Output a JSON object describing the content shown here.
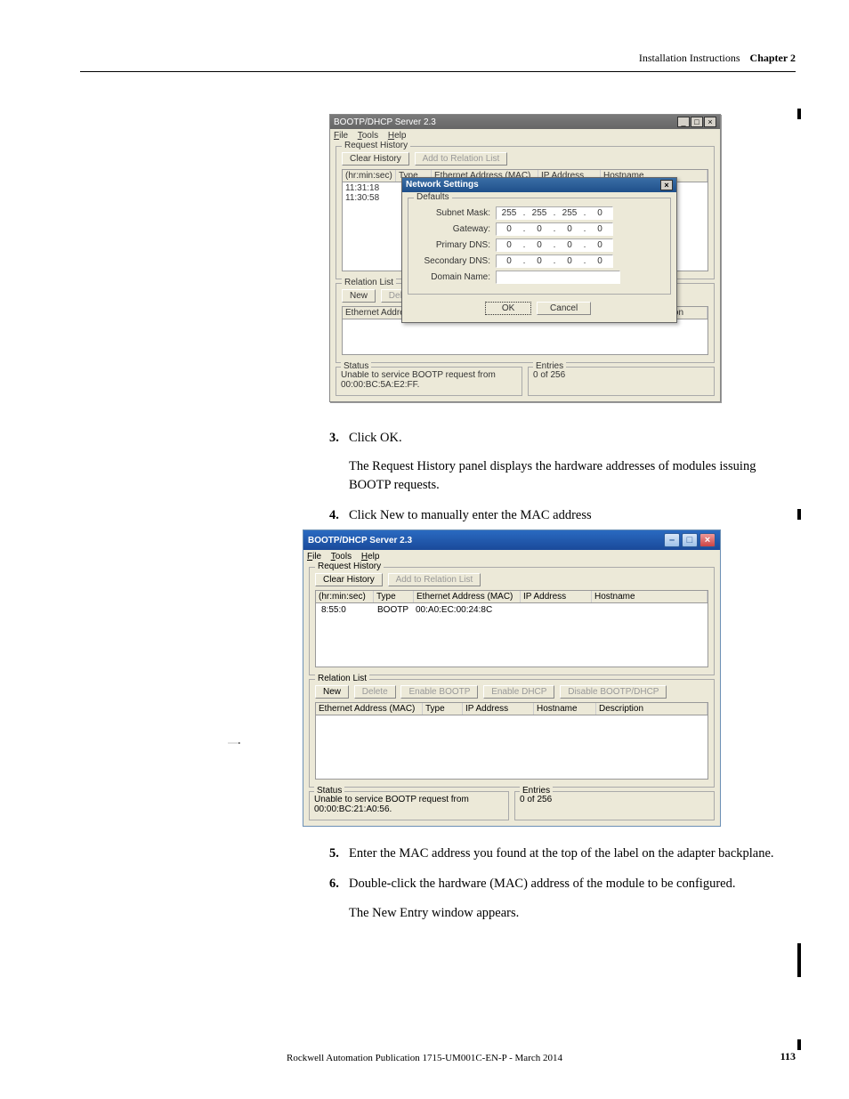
{
  "header": {
    "title": "Installation Instructions",
    "chapter": "Chapter 2"
  },
  "winOld": {
    "title": "BOOTP/DHCP Server 2.3",
    "menu": {
      "file": "File",
      "tools": "Tools",
      "help": "Help"
    },
    "reqHistory": {
      "legend": "Request History",
      "clearBtn": "Clear History",
      "addBtn": "Add to Relation List",
      "cols": {
        "time": "(hr:min:sec)",
        "type": "Type",
        "mac": "Ethernet Address (MAC)",
        "ip": "IP Address",
        "host": "Hostname"
      },
      "rows": [
        {
          "time": "11:31:18"
        },
        {
          "time": "11:30:58"
        }
      ]
    },
    "relList": {
      "legend": "Relation List",
      "newBtn": "New",
      "delBtn": "Delete",
      "col_mac": "Ethernet Addre",
      "col_desc": "Description"
    },
    "dialog": {
      "title": "Network Settings",
      "defaults": "Defaults",
      "subnet": {
        "label": "Subnet Mask:",
        "a": "255",
        "b": "255",
        "c": "255",
        "d": "0"
      },
      "gateway": {
        "label": "Gateway:",
        "a": "0",
        "b": "0",
        "c": "0",
        "d": "0"
      },
      "pdns": {
        "label": "Primary DNS:",
        "a": "0",
        "b": "0",
        "c": "0",
        "d": "0"
      },
      "sdns": {
        "label": "Secondary DNS:",
        "a": "0",
        "b": "0",
        "c": "0",
        "d": "0"
      },
      "domain": {
        "label": "Domain Name:",
        "value": ""
      },
      "ok": "OK",
      "cancel": "Cancel"
    },
    "status": {
      "legend": "Status",
      "text": "Unable to service BOOTP request from 00:00:BC:5A:E2:FF."
    },
    "entries": {
      "legend": "Entries",
      "text": "0 of 256"
    }
  },
  "steps": {
    "s3": {
      "num": "3.",
      "text": "Click OK.",
      "follow": "The Request History panel displays the hardware addresses of modules issuing BOOTP requests."
    },
    "s4": {
      "num": "4.",
      "text": "Click New to manually enter the MAC address"
    },
    "s5": {
      "num": "5.",
      "text": "Enter the MAC address you found at the top of the label on the adapter backplane."
    },
    "s6": {
      "num": "6.",
      "text": "Double-click the hardware (MAC) address of the module to be configured.",
      "follow": "The New Entry window appears."
    }
  },
  "winNew": {
    "title": "BOOTP/DHCP Server 2.3",
    "menu": {
      "file": "File",
      "tools": "Tools",
      "help": "Help"
    },
    "reqHistory": {
      "legend": "Request History",
      "clearBtn": "Clear History",
      "addBtn": "Add to Relation List",
      "cols": {
        "time": "(hr:min:sec)",
        "type": "Type",
        "mac": "Ethernet Address (MAC)",
        "ip": "IP Address",
        "host": "Hostname"
      },
      "row": {
        "time": "8:55:0",
        "type": "BOOTP",
        "mac": "00:A0:EC:00:24:8C"
      }
    },
    "relList": {
      "legend": "Relation List",
      "newBtn": "New",
      "delBtn": "Delete",
      "enBootp": "Enable BOOTP",
      "enDhcp": "Enable DHCP",
      "disBoth": "Disable BOOTP/DHCP",
      "cols": {
        "mac": "Ethernet Address (MAC)",
        "type": "Type",
        "ip": "IP Address",
        "host": "Hostname",
        "desc": "Description"
      }
    },
    "status": {
      "legend": "Status",
      "text": "Unable to service BOOTP request from 00:00:BC:21:A0:56."
    },
    "entries": {
      "legend": "Entries",
      "text": "0 of 256"
    }
  },
  "footer": "Rockwell Automation Publication 1715-UM001C-EN-P - March 2014",
  "pageNum": "113"
}
